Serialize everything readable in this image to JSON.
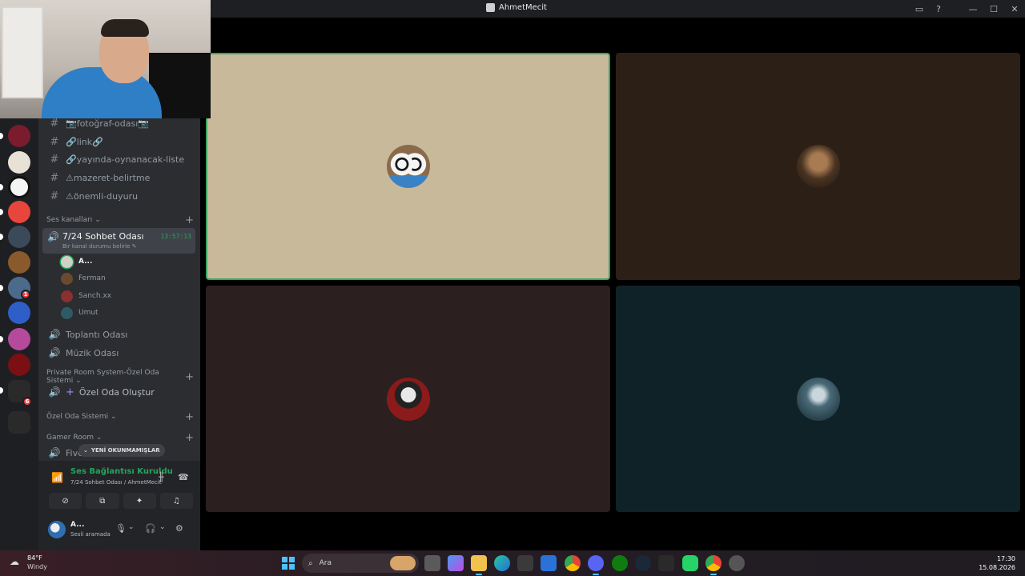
{
  "window": {
    "title": "AhmetMecit",
    "controls": {
      "inbox": "▭",
      "help": "?",
      "minimize": "—",
      "maximize": "☐",
      "close": "✕"
    }
  },
  "sidebar": {
    "text_channels": [
      {
        "name": "📷fotoğraf-odası📷"
      },
      {
        "name": "🔗link🔗"
      },
      {
        "name": "🔗yayında-oynanacak-liste"
      },
      {
        "name": "⚠mazeret-belirtme"
      },
      {
        "name": "⚠önemli-duyuru"
      }
    ],
    "voice_category": "Ses kanalları",
    "active_voice": {
      "name": "7/24 Sohbet Odası",
      "status_hint": "Bir kanal durumu belirle",
      "timer": "13:57:13",
      "members": [
        {
          "name": "A..."
        },
        {
          "name": "Ferman"
        },
        {
          "name": "Sanch.xx"
        },
        {
          "name": "Umut"
        }
      ]
    },
    "voice_channels": [
      {
        "name": "Toplantı Odası"
      },
      {
        "name": "Müzik Odası"
      }
    ],
    "private_category": "Private Room System-Özel Oda Sistemi",
    "create_room": "Özel Oda Oluştur",
    "private_category_2": "Özel Oda Sistemi",
    "gamer_category": "Gamer Room",
    "gamer_channel": "Fivem",
    "unread_label": "YENİ OKUNMAMIŞLAR"
  },
  "server_rail": {
    "badges": [
      "1",
      "6"
    ],
    "ns_label": "Ns"
  },
  "voice_panel": {
    "status": "Ses Bağlantısı Kuruldu",
    "channel": "7/24 Sohbet Odası / AhmetMecit",
    "user_name": "A...",
    "user_status": "Sesli aramada"
  },
  "colors": {
    "accent_green": "#23a55a",
    "speaking_border": "#3ba55c",
    "sidebar_bg": "#2b2d31",
    "rail_bg": "#1e1f22"
  },
  "taskbar": {
    "weather_temp": "84°F",
    "weather_desc": "Windy",
    "search_placeholder": "Ara",
    "time": "17:30",
    "date": "15.08.2026"
  }
}
